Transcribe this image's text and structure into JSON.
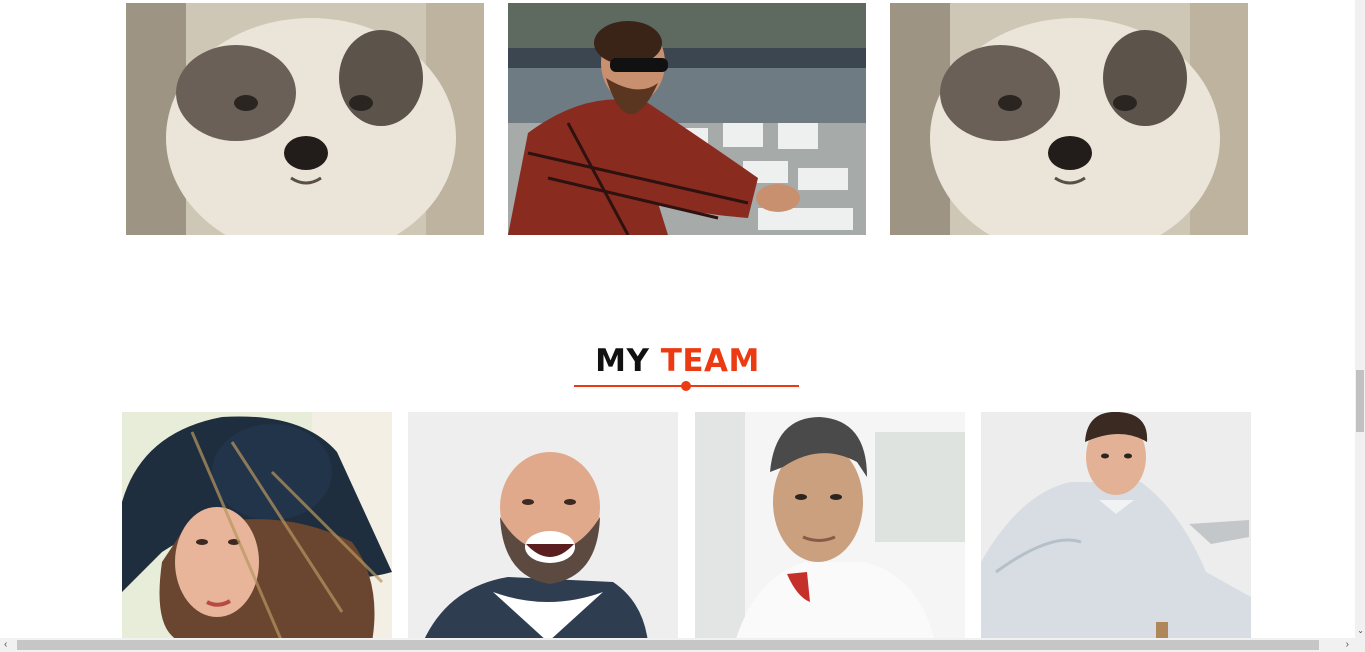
{
  "gallery": {
    "images": [
      {
        "subject": "puppy-photo"
      },
      {
        "subject": "bearded-man-photo"
      },
      {
        "subject": "puppy-photo"
      }
    ]
  },
  "team_section": {
    "title_part1": "MY",
    "title_part2": "TEAM",
    "accent_color": "#ec3b12",
    "members": [
      {
        "photo": "woman-in-hat-photo"
      },
      {
        "photo": "laughing-bald-man-photo"
      },
      {
        "photo": "man-white-polo-photo"
      },
      {
        "photo": "man-with-tablet-photo"
      }
    ]
  },
  "scrollbars": {
    "left_arrow": "‹",
    "right_arrow": "›",
    "down_arrow": "⌄"
  }
}
